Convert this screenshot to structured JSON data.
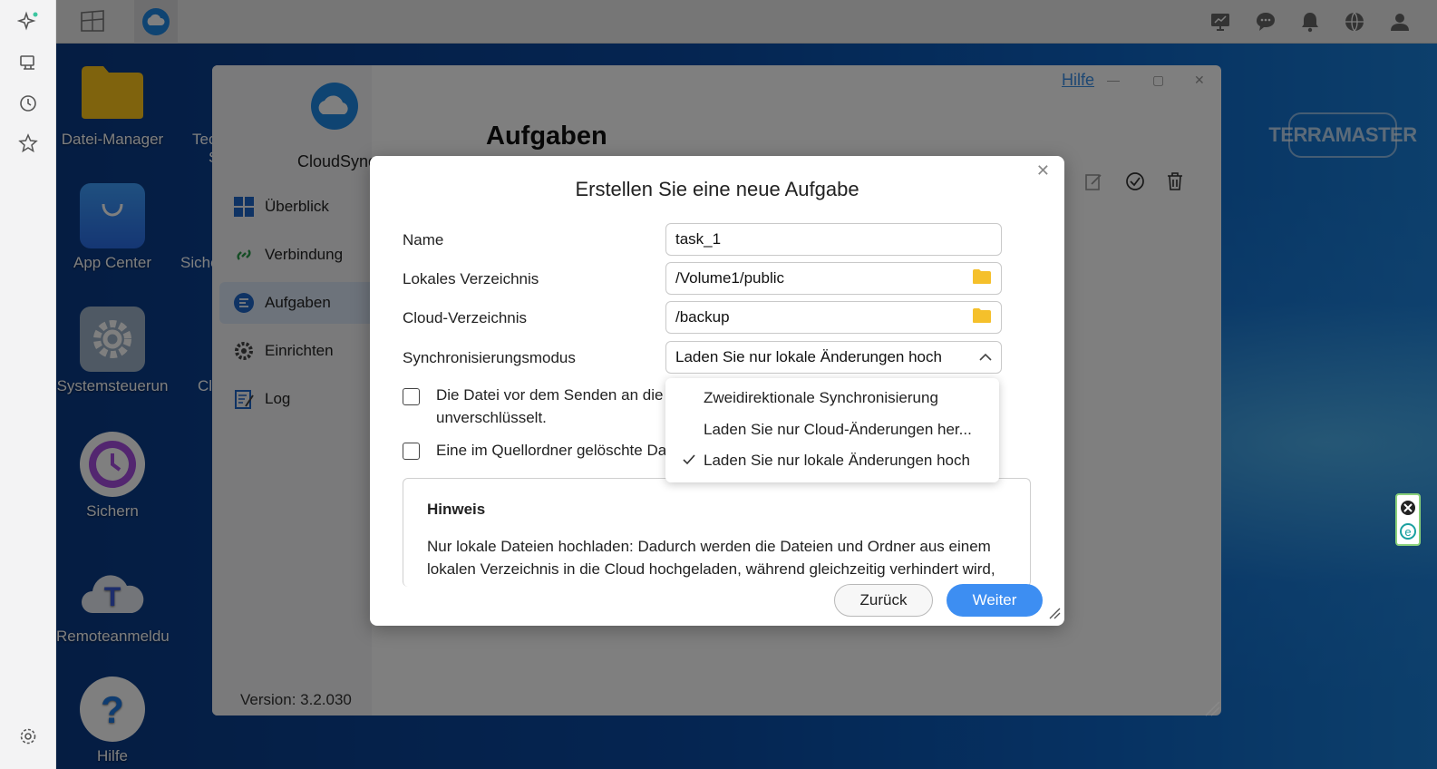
{
  "taskbar": {
    "apps": [
      {
        "name": "desktop-view-icon"
      },
      {
        "name": "cloudsync-taskbar-icon"
      }
    ],
    "tray": [
      "monitor-icon",
      "chat-icon",
      "bell-icon",
      "globe-icon",
      "user-icon"
    ]
  },
  "rail": {
    "icons": [
      "sparkle-icon",
      "device-icon",
      "clock-icon",
      "star-icon",
      "settings-icon"
    ]
  },
  "desktop": {
    "icons": [
      {
        "label": "Datei-Manager"
      },
      {
        "label": "App Center"
      },
      {
        "label": "Systemsteuerun"
      },
      {
        "label": "Sichern"
      },
      {
        "label": "Remoteanmeldu"
      },
      {
        "label": "Hilfe"
      },
      {
        "label": "Tec"
      },
      {
        "label": "S"
      },
      {
        "label": "Siche"
      },
      {
        "label": "Cl"
      }
    ],
    "brand": "TERRAMASTER"
  },
  "app": {
    "name": "CloudSync",
    "page_title": "Aufgaben",
    "help": "Hilfe",
    "version": "Version: 3.2.030",
    "nav": [
      {
        "label": "Überblick"
      },
      {
        "label": "Verbindung"
      },
      {
        "label": "Aufgaben"
      },
      {
        "label": "Einrichten"
      },
      {
        "label": "Log"
      }
    ]
  },
  "dialog": {
    "title": "Erstellen Sie eine neue Aufgabe",
    "fields": {
      "name_label": "Name",
      "name_value": "task_1",
      "local_label": "Lokales Verzeichnis",
      "local_value": "/Volume1/public",
      "cloud_label": "Cloud-Verzeichnis",
      "cloud_value": "/backup",
      "mode_label": "Synchronisierungsmodus",
      "mode_value": "Laden Sie nur lokale Änderungen hoch"
    },
    "checkboxes": {
      "encrypt_line1": "Die Datei vor dem Senden an die",
      "encrypt_line2": "unverschlüsselt.",
      "delete_text": "Eine im Quellordner gelöschte Da"
    },
    "hint": {
      "title": "Hinweis",
      "text": "Nur lokale Dateien hochladen: Dadurch werden die Dateien und Ordner aus einem lokalen Verzeichnis in die Cloud hochgeladen, während gleichzeitig verhindert wird,"
    },
    "buttons": {
      "back": "Zurück",
      "next": "Weiter"
    },
    "dropdown": {
      "options": [
        {
          "label": "Zweidirektionale Synchronisierung",
          "selected": false
        },
        {
          "label": "Laden Sie nur Cloud-Änderungen her...",
          "selected": false
        },
        {
          "label": "Laden Sie nur lokale Änderungen hoch",
          "selected": true
        }
      ]
    }
  },
  "colors": {
    "accent": "#3d8ef2",
    "folder": "#f5c02b"
  }
}
